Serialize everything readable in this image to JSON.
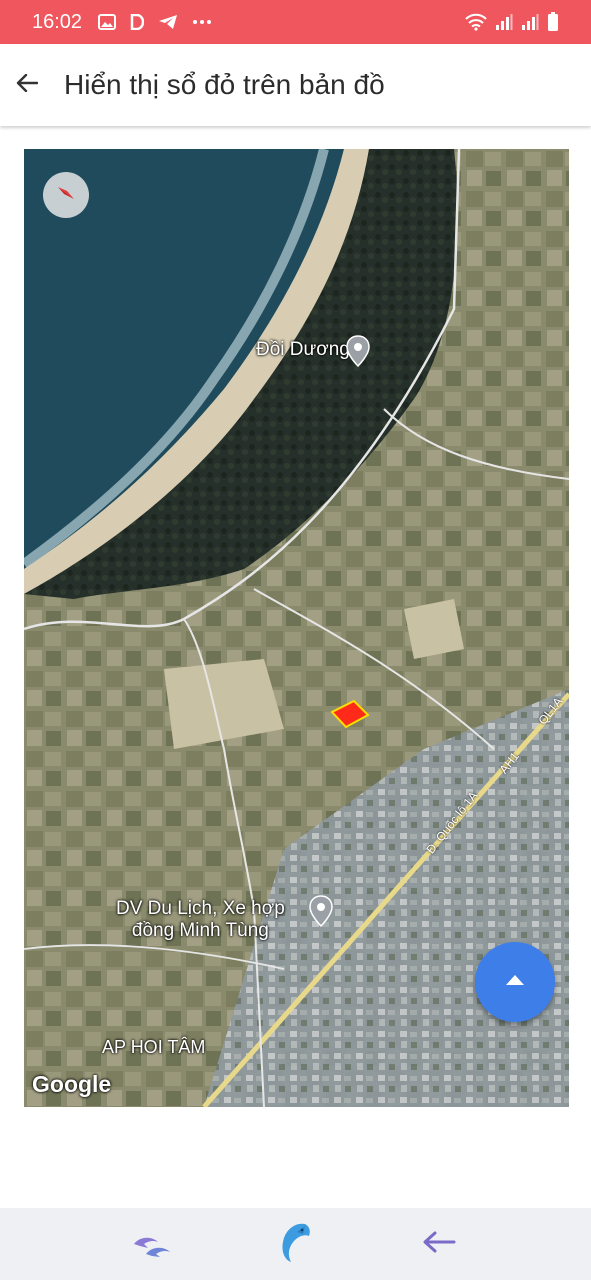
{
  "status_bar": {
    "time": "16:02",
    "left_icons": [
      "image-icon",
      "d-app-icon",
      "telegram-icon",
      "more-dots-icon"
    ],
    "right_icons": [
      "wifi-icon",
      "signal-icon",
      "signal-icon",
      "battery-icon"
    ]
  },
  "app_bar": {
    "title": "Hiển thị sổ đỏ trên bản đồ",
    "back_icon": "arrow-left-icon"
  },
  "map": {
    "labels": {
      "place_1": "Đồi Dương",
      "place_2": "DV Du Lịch, Xe hợp\nđồng Minh Tùng",
      "place_3": "AP HOI TÂM",
      "road_1": "Đ. Quốc lộ 1A",
      "road_2": "AH1",
      "road_3": "QL1A"
    },
    "logo": "Google",
    "compass_icon": "compass-icon",
    "parcel_color": "#ff2a1a",
    "fab_icon": "caret-up-icon",
    "fab_color": "#3d7ee8"
  },
  "bottom_nav": {
    "items": [
      "dolphins-icon",
      "dolphin-icon",
      "arrow-left-icon"
    ]
  },
  "colors": {
    "status_bar": "#f0565e",
    "nav_bar": "#eff0f4"
  }
}
